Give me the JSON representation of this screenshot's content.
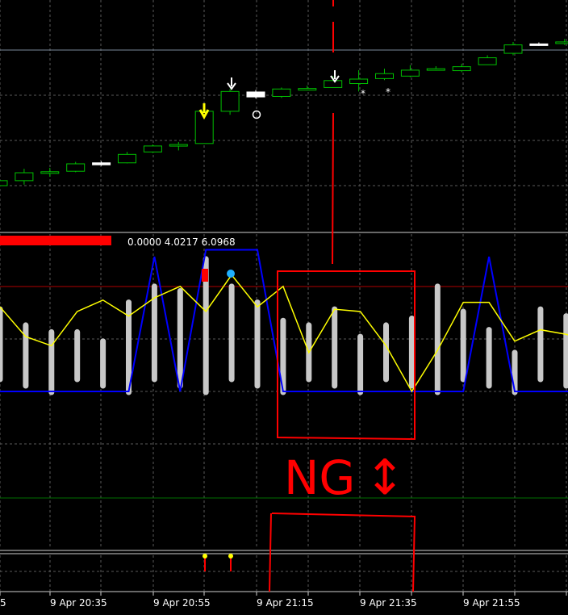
{
  "window": {
    "platform": "MetaTrader",
    "background": "#000000"
  },
  "colors": {
    "candle_up": "#00c000",
    "candle_down_body": "#ffffff",
    "grid": "#5a5a5a",
    "signal_arrow_yellow": "#ffff00",
    "signal_arrow_white": "#ffffff",
    "hist_bar": "#c8c8c8",
    "line_blue": "#0000ff",
    "line_yellow": "#ffff00",
    "level_red": "#b00000",
    "marker_red": "#ff0000",
    "marker_cyan": "#20b0ff",
    "annotation_red": "#ff0000"
  },
  "indicator_window": {
    "values_text": "0.0000 4.0217 6.0968"
  },
  "time_axis": {
    "partial_left_label": "5",
    "labels": [
      "9 Apr 20:35",
      "9 Apr 20:55",
      "9 Apr 21:15",
      "9 Apr 21:35",
      "9 Apr 21:55"
    ]
  },
  "annotation": {
    "text": "NG",
    "arrow_glyph": "↕"
  },
  "chart_data": {
    "type": "candlestick",
    "candles": [
      {
        "o": 0,
        "c": 1,
        "h": 1.2,
        "l": -0.2
      },
      {
        "o": 1,
        "c": 2.6,
        "h": 3.4,
        "l": 0.2
      },
      {
        "o": 2.6,
        "c": 2.8,
        "h": 3.6,
        "l": 1.8
      },
      {
        "o": 2.9,
        "c": 4.4,
        "h": 4.8,
        "l": 2.7
      },
      {
        "o": 4.6,
        "c": 4.2,
        "h": 4.9,
        "l": 4.0
      },
      {
        "o": 4.6,
        "c": 6.3,
        "h": 6.8,
        "l": 4.5
      },
      {
        "o": 6.8,
        "c": 8.0,
        "h": 8.3,
        "l": 6.6
      },
      {
        "o": 8.1,
        "c": 8.3,
        "h": 8.8,
        "l": 7.1
      },
      {
        "o": 8.5,
        "c": 15.0,
        "h": 15.3,
        "l": 8.5
      },
      {
        "o": 15.0,
        "c": 19.0,
        "h": 19.5,
        "l": 14.3
      },
      {
        "o": 18.9,
        "c": 17.9,
        "h": 19.3,
        "l": 17.6
      },
      {
        "o": 18.0,
        "c": 19.5,
        "h": 19.8,
        "l": 17.7
      },
      {
        "o": 19.4,
        "c": 19.6,
        "h": 20.2,
        "l": 19.2
      },
      {
        "o": 19.8,
        "c": 21.2,
        "h": 22.1,
        "l": 19.8
      },
      {
        "o": 20.6,
        "c": 21.5,
        "h": 23.3,
        "l": 19.0
      },
      {
        "o": 21.6,
        "c": 22.6,
        "h": 23.6,
        "l": 21.3
      },
      {
        "o": 22.1,
        "c": 23.3,
        "h": 24.3,
        "l": 21.9
      },
      {
        "o": 23.4,
        "c": 23.6,
        "h": 24.1,
        "l": 23.2
      },
      {
        "o": 23.2,
        "c": 24.0,
        "h": 24.6,
        "l": 22.9
      },
      {
        "o": 24.4,
        "c": 25.8,
        "h": 26.3,
        "l": 24.4
      },
      {
        "o": 26.7,
        "c": 28.4,
        "h": 29.0,
        "l": 26.3
      },
      {
        "o": 28.6,
        "c": 28.3,
        "h": 28.9,
        "l": 28.2
      },
      {
        "o": 28.7,
        "c": 29.0,
        "h": 29.6,
        "l": 28.4
      },
      {
        "o": 29.2,
        "c": 29.6,
        "h": 30.6,
        "l": 29.0
      }
    ],
    "histogram": [
      3.6,
      2.9,
      2.6,
      2.6,
      2.2,
      3.9,
      4.6,
      4.4,
      5.8,
      4.6,
      3.9,
      3.1,
      2.9,
      3.6,
      2.4,
      2.9,
      3.2,
      4.6,
      3.5,
      2.7,
      1.7,
      3.6,
      3.3,
      3.5
    ],
    "blue_line": [
      0,
      0,
      0,
      0,
      0,
      0,
      5.9,
      0,
      6.2,
      6.2,
      6.2,
      0,
      0,
      0,
      0,
      0,
      0,
      0,
      0,
      5.9,
      0,
      0,
      0,
      0
    ],
    "yellow_line": [
      3.7,
      2.4,
      2.0,
      3.5,
      4.0,
      3.3,
      4.1,
      4.6,
      3.5,
      5.1,
      3.7,
      4.6,
      1.7,
      3.6,
      3.5,
      2.0,
      0,
      1.8,
      3.9,
      3.9,
      2.2,
      2.7,
      2.5,
      2.2
    ]
  }
}
